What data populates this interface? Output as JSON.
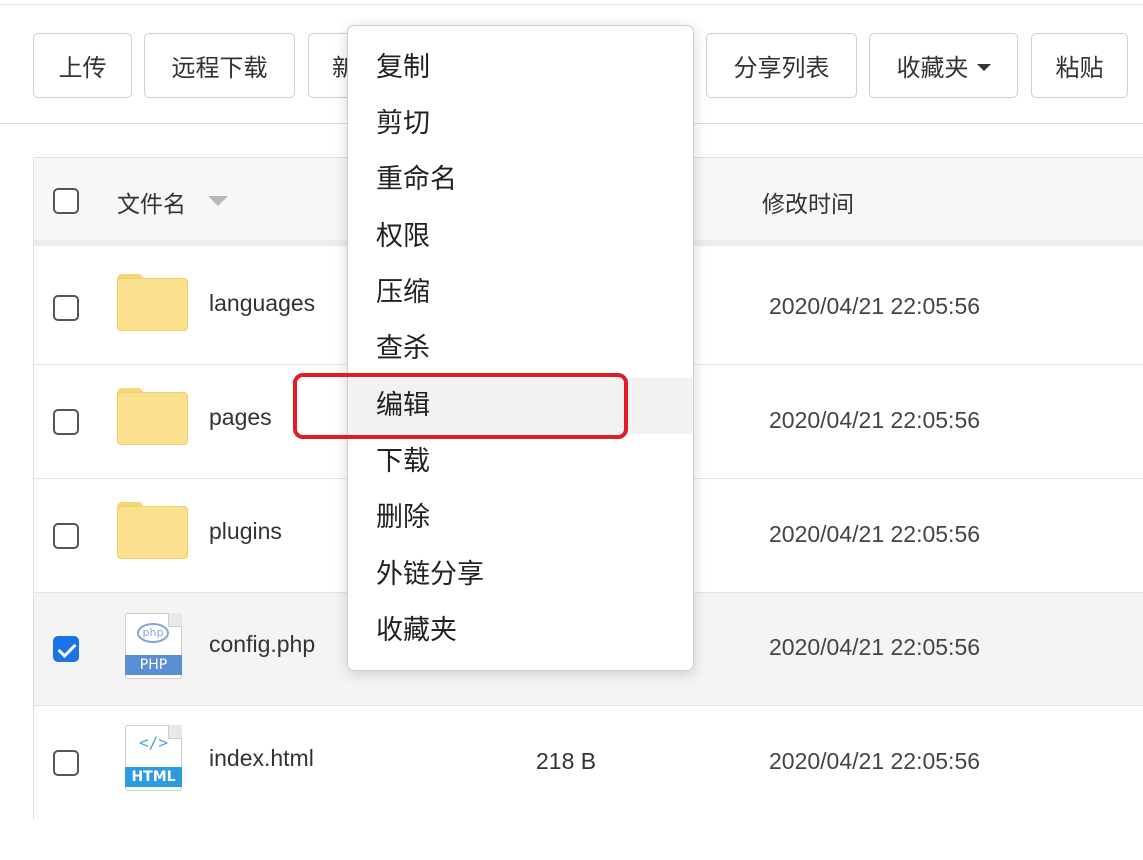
{
  "toolbar": {
    "upload": "上传",
    "remote_download": "远程下载",
    "new_partial": "新",
    "share_list": "分享列表",
    "favorites": "收藏夹",
    "paste": "粘贴"
  },
  "table": {
    "headers": {
      "name": "文件名",
      "modified": "修改时间"
    },
    "rows": [
      {
        "name": "languages",
        "type": "folder",
        "size": "",
        "modified": "2020/04/21 22:05:56",
        "checked": false
      },
      {
        "name": "pages",
        "type": "folder",
        "size": "",
        "modified": "2020/04/21 22:05:56",
        "checked": false
      },
      {
        "name": "plugins",
        "type": "folder",
        "size": "",
        "modified": "2020/04/21 22:05:56",
        "checked": false
      },
      {
        "name": "config.php",
        "type": "php",
        "size": "",
        "modified": "2020/04/21 22:05:56",
        "checked": true
      },
      {
        "name": "index.html",
        "type": "html",
        "size": "218 B",
        "modified": "2020/04/21 22:05:56",
        "checked": false
      }
    ]
  },
  "icons": {
    "php_inner": "php",
    "php_label": "PHP",
    "html_inner": "</>",
    "html_label": "HTML"
  },
  "context_menu": {
    "items": [
      "复制",
      "剪切",
      "重命名",
      "权限",
      "压缩",
      "查杀",
      "编辑",
      "下载",
      "删除",
      "外链分享",
      "收藏夹"
    ],
    "highlighted": "编辑"
  },
  "colors": {
    "checkbox_checked": "#1a73e8",
    "folder": "#fbe08d",
    "highlight": "#e21b2a"
  }
}
